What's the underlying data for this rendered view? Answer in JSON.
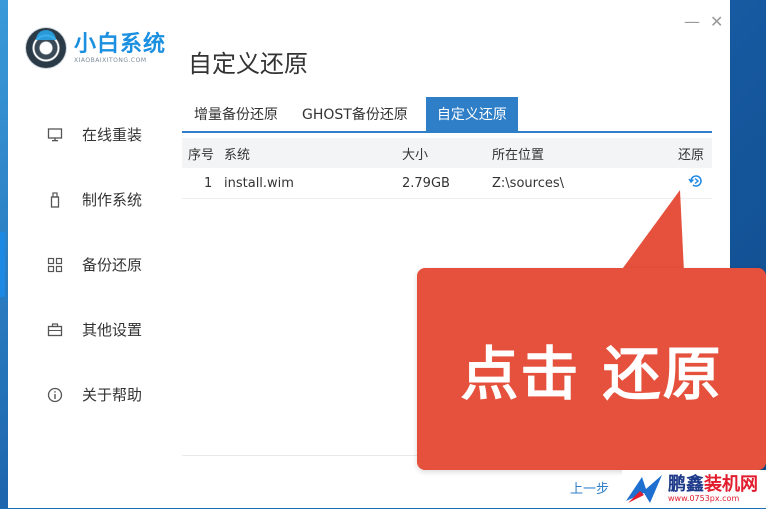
{
  "app": {
    "logo_cn": "小白系统",
    "logo_en": "XIAOBAIXITONG.COM",
    "title": "自定义还原"
  },
  "window_controls": {
    "minimize": "—",
    "close": "✕"
  },
  "sidebar": {
    "items": [
      {
        "label": "在线重装",
        "icon": "monitor-icon",
        "active": false
      },
      {
        "label": "制作系统",
        "icon": "usb-icon",
        "active": false
      },
      {
        "label": "备份还原",
        "icon": "grid-icon",
        "active": true
      },
      {
        "label": "其他设置",
        "icon": "briefcase-icon",
        "active": false
      },
      {
        "label": "关于帮助",
        "icon": "info-icon",
        "active": false
      }
    ]
  },
  "tabs": [
    {
      "label": "增量备份还原",
      "active": false
    },
    {
      "label": "GHOST备份还原",
      "active": false
    },
    {
      "label": "自定义还原",
      "active": true
    }
  ],
  "table": {
    "headers": {
      "index": "序号",
      "system": "系统",
      "size": "大小",
      "location": "所在位置",
      "action": "还原"
    },
    "rows": [
      {
        "index": "1",
        "system": "install.wim",
        "size": "2.79GB",
        "location": "Z:\\sources\\",
        "action_icon": "restore-icon"
      }
    ]
  },
  "footer": {
    "prev": "上一步"
  },
  "callout": {
    "text": "点击 还原",
    "color": "#e5513c"
  },
  "watermark": {
    "cn_part1": "鹏鑫",
    "cn_part2": "装机网",
    "url": "www.0753px.com"
  },
  "colors": {
    "accent": "#2f7ec8",
    "brand": "#1b8fe0"
  }
}
